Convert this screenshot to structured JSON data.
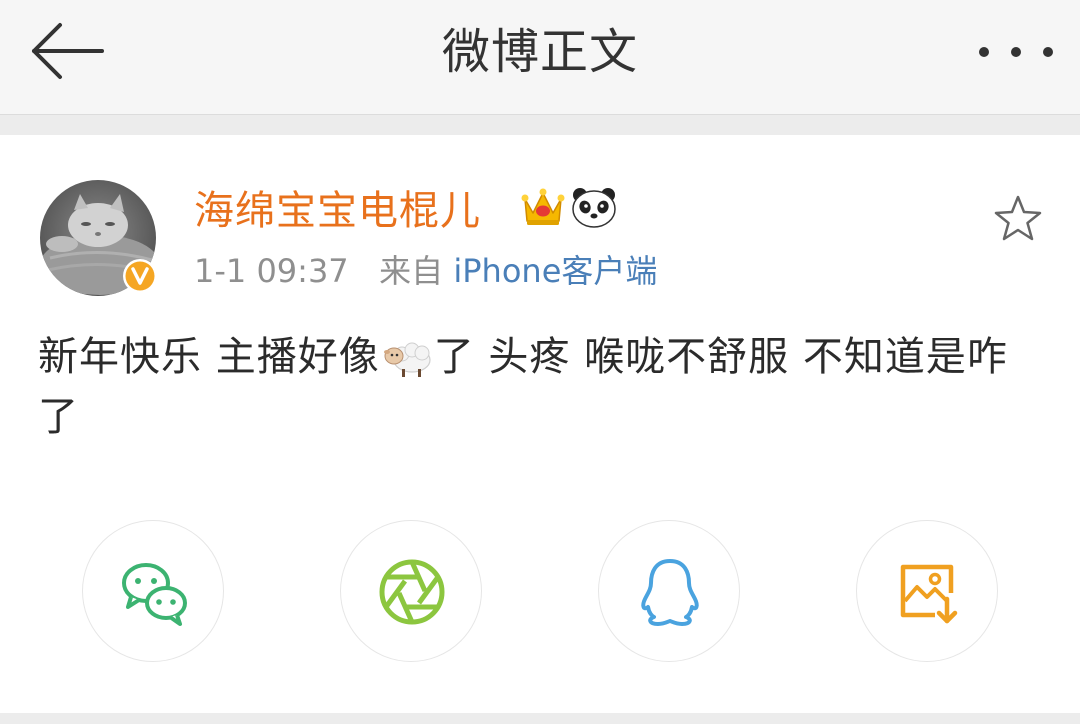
{
  "header": {
    "title": "微博正文",
    "back_icon": "arrow-left-icon",
    "more_icon": "more-dots-icon"
  },
  "post": {
    "author": {
      "name": "海绵宝宝电棍儿",
      "avatar_icon": "cat-avatar",
      "verified_badge": "v-verified-icon",
      "badges": [
        "crown-icon",
        "panda-icon"
      ]
    },
    "time": "1-1 09:37",
    "source_prefix": "来自",
    "source_name": "iPhone客户端",
    "favorite_icon": "star-outline-icon",
    "text_part1": "新年快乐 主播好像",
    "text_emoji": "sheep-emoji",
    "text_part2": "了 头疼 喉咙不舒服 不知道是咋了"
  },
  "share": {
    "items": [
      {
        "icon": "wechat-icon",
        "color": "#3cb371"
      },
      {
        "icon": "moments-shutter-icon",
        "color": "#8cc63f"
      },
      {
        "icon": "qq-icon",
        "color": "#4aa3df"
      },
      {
        "icon": "save-image-icon",
        "color": "#f0a020"
      }
    ]
  },
  "colors": {
    "username": "#e8711c",
    "source_link": "#4a7fb8",
    "meta_text": "#8f8f8f",
    "verified": "#f5a623"
  }
}
